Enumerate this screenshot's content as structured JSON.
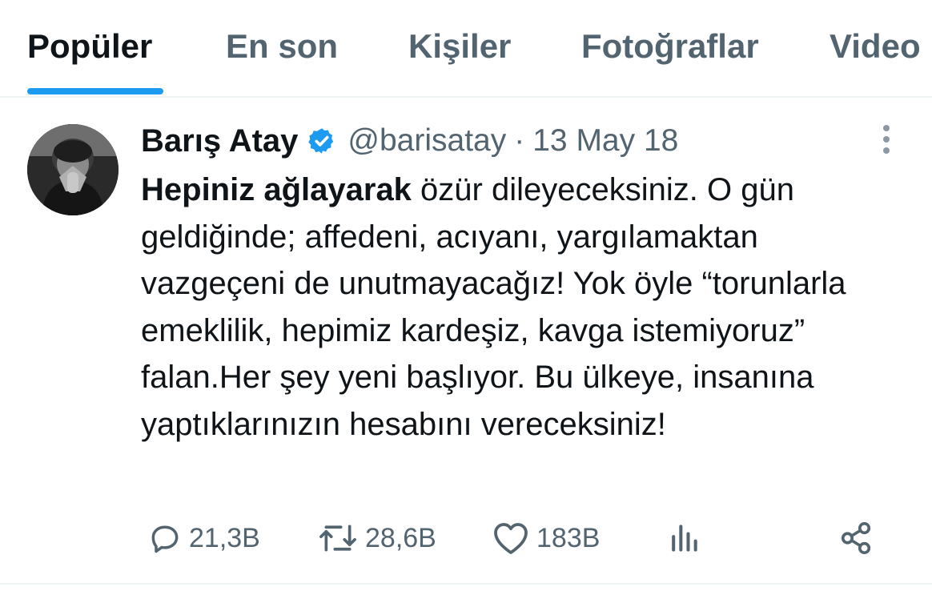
{
  "tabs": [
    {
      "label": "Popüler",
      "active": true
    },
    {
      "label": "En son",
      "active": false
    },
    {
      "label": "Kişiler",
      "active": false
    },
    {
      "label": "Fotoğraflar",
      "active": false
    },
    {
      "label": "Video",
      "active": false
    }
  ],
  "tweet": {
    "author_name": "Barış Atay",
    "handle": "@barisatay",
    "separator": "·",
    "time": "13 May 18",
    "verified": true,
    "text_bold": "Hepiniz ağlayarak",
    "text_rest": " özür dileyeceksiniz. O gün geldiğinde; affedeni, acıyanı, yargılamaktan vazgeçeni de unutmayacağız! Yok öyle “torunlarla emeklilik, hepimiz kardeşiz, kavga istemiyoruz” falan.Her şey yeni başlıyor. Bu ülkeye, insanına yaptıklarınızın hesabını vereceksiniz!",
    "actions": {
      "replies": "21,3B",
      "retweets": "28,6B",
      "likes": "183B"
    }
  },
  "icons": {
    "verified": "verified-badge-icon",
    "more": "more-vertical-icon",
    "reply": "reply-icon",
    "retweet": "retweet-icon",
    "like": "heart-icon",
    "views": "views-icon",
    "share": "share-icon"
  },
  "colors": {
    "accent": "#1d9bf0",
    "text_primary": "#0f1419",
    "text_secondary": "#536471",
    "divider": "#eff3f4"
  }
}
